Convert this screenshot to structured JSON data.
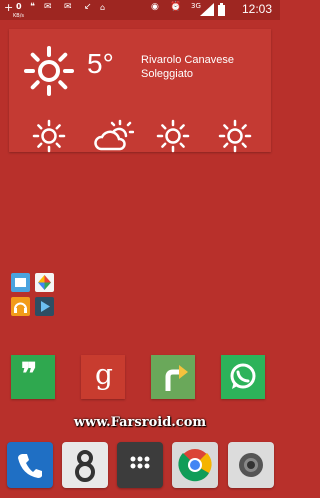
{
  "status_bar": {
    "notification_count": "0",
    "data_rate": "KB/s",
    "network_type": "3G",
    "time": "12:03",
    "icons": [
      "add-icon",
      "hangouts-icon",
      "messages-icon",
      "gmail-icon",
      "missed-call-icon",
      "sim-icon",
      "eye-icon",
      "alarm-icon",
      "signal-icon",
      "battery-icon"
    ]
  },
  "weather": {
    "temperature": "5°",
    "location": "Rivarolo Canavese",
    "condition": "Soleggiato",
    "main_icon": "sun-icon",
    "forecast_icons": [
      "sun-icon",
      "partly-cloudy-icon",
      "sun-icon",
      "sun-icon"
    ]
  },
  "folder": {
    "apps": [
      "play-store-icon",
      "photos-icon",
      "play-music-icon",
      "play-movies-icon"
    ]
  },
  "home_row": [
    {
      "name": "hangouts",
      "color": "#2fa84f",
      "glyph": "❞"
    },
    {
      "name": "google-plus",
      "color": "#c83c2f",
      "glyph": "g"
    },
    {
      "name": "maps",
      "color": "#6aa85a",
      "glyph": "↱"
    },
    {
      "name": "whatsapp",
      "color": "#2db35a",
      "glyph": "✆"
    }
  ],
  "watermark": "www.Farsroid.com",
  "dock": [
    {
      "name": "phone",
      "color": "#1f6fc4"
    },
    {
      "name": "contacts",
      "color": "#e8e8e8"
    },
    {
      "name": "app-drawer",
      "color": "#3c3c3c"
    },
    {
      "name": "chrome",
      "color": "#d9d9d9"
    },
    {
      "name": "camera",
      "color": "#dcdcdc"
    }
  ]
}
